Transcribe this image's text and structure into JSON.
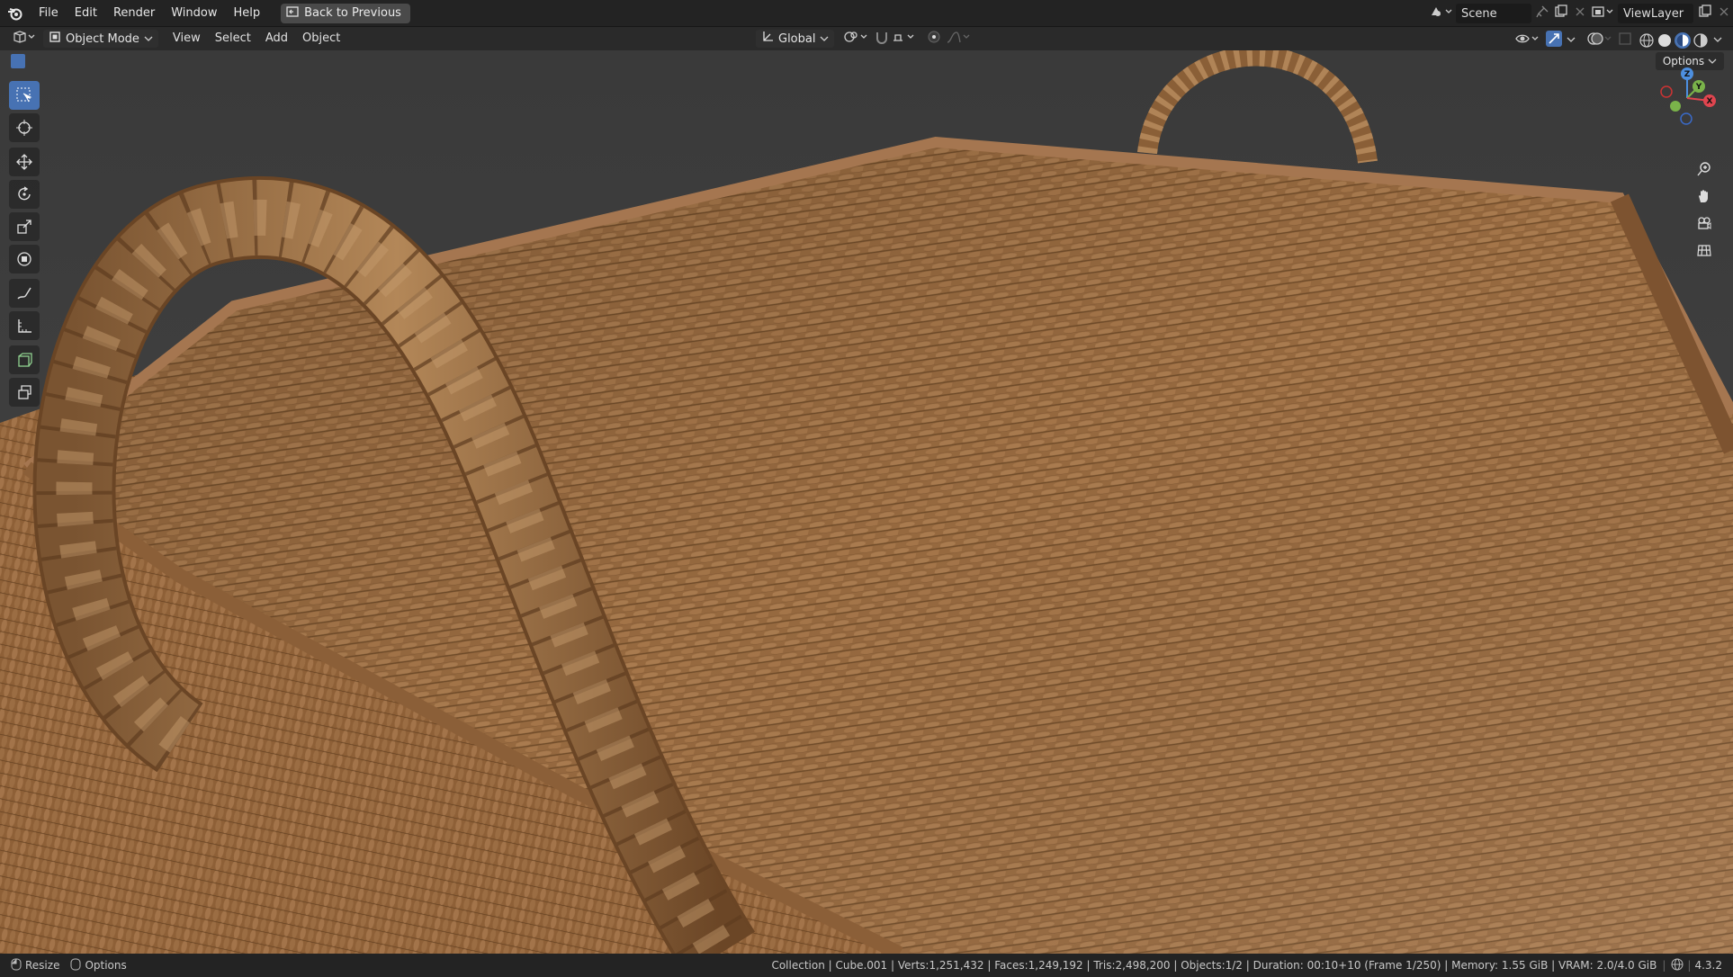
{
  "topbar": {
    "menu": [
      "File",
      "Edit",
      "Render",
      "Window",
      "Help"
    ],
    "back_button": "Back to Previous",
    "scene_field": "Scene",
    "viewlayer_field": "ViewLayer"
  },
  "header": {
    "mode": "Object Mode",
    "menus": [
      "View",
      "Select",
      "Add",
      "Object"
    ],
    "transform_orientation": "Global",
    "options_label": "Options"
  },
  "viewport": {
    "gizmo_axes": {
      "z": "Z",
      "y": "Y",
      "x": "X"
    },
    "tools": [
      "select-box",
      "cursor",
      "move",
      "rotate",
      "scale",
      "transform",
      "annotate",
      "measure",
      "add-cube",
      "extrude"
    ],
    "colors": {
      "background": "#3e3e3e",
      "wicker": "#9c7047",
      "accent": "#4772b3"
    }
  },
  "statusbar": {
    "left_resize": "Resize",
    "left_options": "Options",
    "stats": "Collection | Cube.001 | Verts:1,251,432 | Faces:1,249,192 | Tris:2,498,200 | Objects:1/2 | Duration: 00:10+10 (Frame 1/250) | Memory: 1.55 GiB | VRAM: 2.0/4.0 GiB",
    "version": "4.3.2"
  }
}
